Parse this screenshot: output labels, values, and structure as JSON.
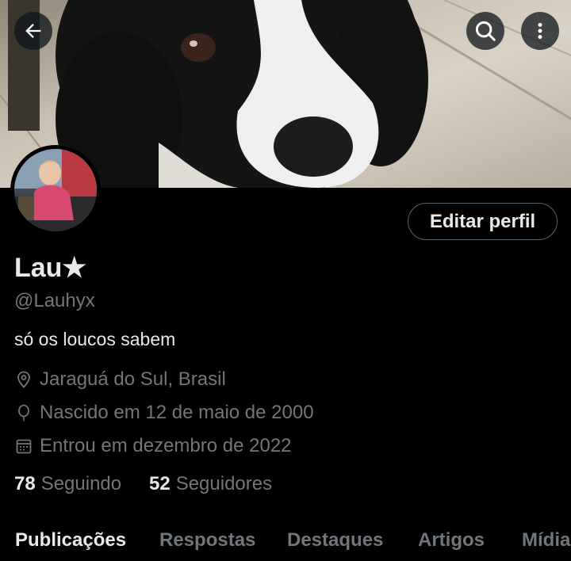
{
  "header": {
    "back_icon": "arrow-left-icon",
    "search_icon": "search-icon",
    "more_icon": "more-vertical-icon"
  },
  "profile": {
    "edit_label": "Editar perfil",
    "name": "Lau★",
    "handle": "@Lauhyx",
    "bio": "só os loucos sabem",
    "location": "Jaraguá do Sul, Brasil",
    "birth": "Nascido em 12 de maio de 2000",
    "joined": "Entrou em dezembro de 2022"
  },
  "stats": {
    "following_count": "78",
    "following_label": "Seguindo",
    "followers_count": "52",
    "followers_label": "Seguidores"
  },
  "tabs": [
    {
      "label": "Publicações"
    },
    {
      "label": "Respostas"
    },
    {
      "label": "Destaques"
    },
    {
      "label": "Artigos"
    },
    {
      "label": "Mídia"
    }
  ],
  "colors": {
    "background": "#000000",
    "text_primary": "#e7e9ea",
    "text_secondary": "#71767b",
    "border": "#536471"
  }
}
